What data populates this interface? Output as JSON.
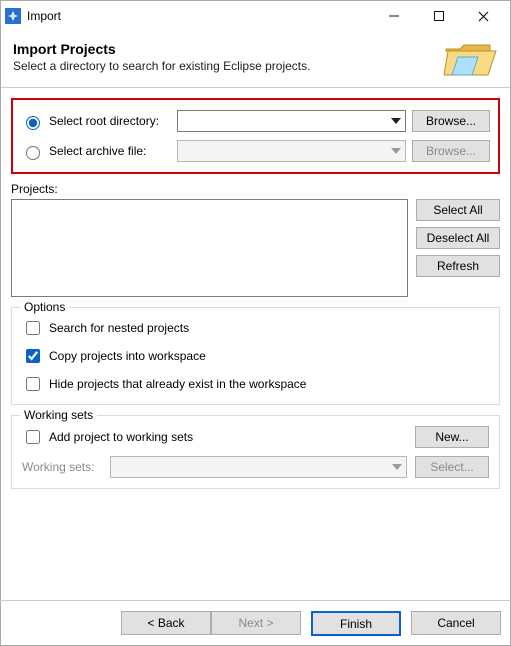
{
  "window": {
    "title": "Import"
  },
  "banner": {
    "heading": "Import Projects",
    "subtext": "Select a directory to search for existing Eclipse projects."
  },
  "source": {
    "root_radio_label": "Select root directory:",
    "archive_radio_label": "Select archive file:",
    "root_value": "",
    "archive_value": "",
    "browse_label": "Browse...",
    "browse_disabled_label": "Browse..."
  },
  "projects": {
    "label": "Projects:",
    "items": [],
    "select_all": "Select All",
    "deselect_all": "Deselect All",
    "refresh": "Refresh"
  },
  "options": {
    "legend": "Options",
    "nested_label": "Search for nested projects",
    "copy_label": "Copy projects into workspace",
    "hide_label": "Hide projects that already exist in the workspace",
    "nested_checked": false,
    "copy_checked": true,
    "hide_checked": false
  },
  "working_sets": {
    "legend": "Working sets",
    "add_label": "Add project to working sets",
    "add_checked": false,
    "new_label": "New...",
    "select_row_label": "Working sets:",
    "select_value": "",
    "select_button": "Select..."
  },
  "footer": {
    "back": "< Back",
    "next": "Next >",
    "finish": "Finish",
    "cancel": "Cancel"
  }
}
